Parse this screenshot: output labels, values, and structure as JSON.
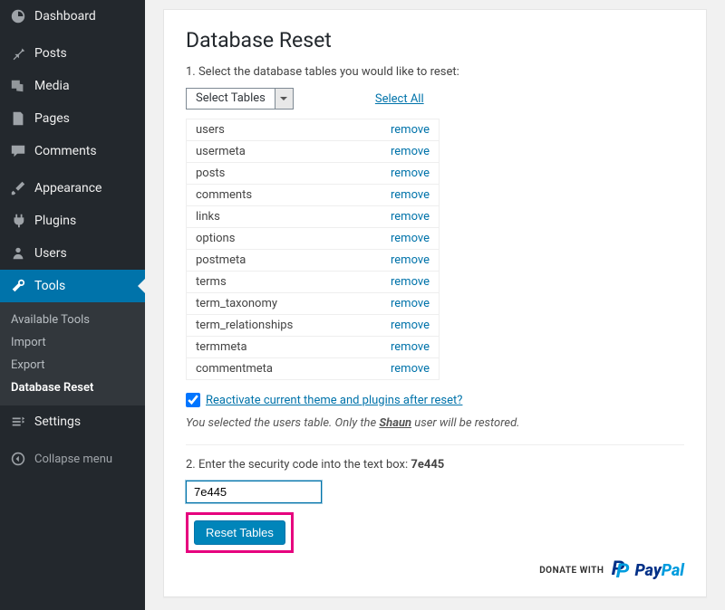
{
  "sidebar": {
    "items": [
      {
        "label": "Dashboard"
      },
      {
        "label": "Posts"
      },
      {
        "label": "Media"
      },
      {
        "label": "Pages"
      },
      {
        "label": "Comments"
      },
      {
        "label": "Appearance"
      },
      {
        "label": "Plugins"
      },
      {
        "label": "Users"
      },
      {
        "label": "Tools"
      },
      {
        "label": "Settings"
      }
    ],
    "tools_sub": [
      {
        "label": "Available Tools"
      },
      {
        "label": "Import"
      },
      {
        "label": "Export"
      },
      {
        "label": "Database Reset"
      }
    ],
    "collapse": "Collapse menu"
  },
  "page": {
    "title": "Database Reset",
    "step1_label": "1. Select the database tables you would like to reset:",
    "select_placeholder": "Select Tables",
    "select_all": "Select All",
    "remove_label": "remove",
    "tables": [
      {
        "name": "users"
      },
      {
        "name": "usermeta"
      },
      {
        "name": "posts"
      },
      {
        "name": "comments"
      },
      {
        "name": "links"
      },
      {
        "name": "options"
      },
      {
        "name": "postmeta"
      },
      {
        "name": "terms"
      },
      {
        "name": "term_taxonomy"
      },
      {
        "name": "term_relationships"
      },
      {
        "name": "termmeta"
      },
      {
        "name": "commentmeta"
      }
    ],
    "reactivate_label": "Reactivate current theme and plugins after reset?",
    "notice_pre": "You selected the users table. Only the ",
    "notice_user": "Shaun",
    "notice_post": " user will be restored.",
    "step2_pre": "2. Enter the security code into the text box:  ",
    "security_code": "7e445",
    "input_value": "7e445",
    "reset_button": "Reset Tables",
    "donate_label": "DONATE WITH",
    "paypal_pay": "Pay",
    "paypal_pal": "Pal"
  }
}
